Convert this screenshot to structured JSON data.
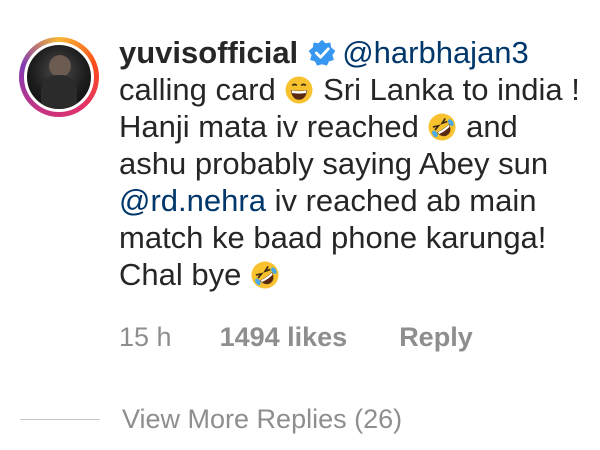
{
  "comment": {
    "username": "yuvisofficial",
    "mention_1": "@harbhajan3",
    "text_1": "calling card",
    "text_2": "Sri Lanka to india ! Hanji mata iv reached",
    "text_3": "and ashu probably saying Abey sun",
    "mention_2": "@rd.nehra",
    "text_4": "iv reached ab main match ke baad phone karunga! Chal bye",
    "time": "15 h",
    "likes": "1494 likes",
    "reply_label": "Reply"
  },
  "replies": {
    "view_more_label": "View More Replies (26)"
  },
  "icons": {
    "verified": "verified-badge-icon",
    "grin": "grinning-face-emoji-icon",
    "rofl": "rolling-on-floor-laughing-emoji-icon"
  },
  "colors": {
    "mention": "#00376b",
    "verified": "#3897f0",
    "meta": "#8e8e8e"
  }
}
